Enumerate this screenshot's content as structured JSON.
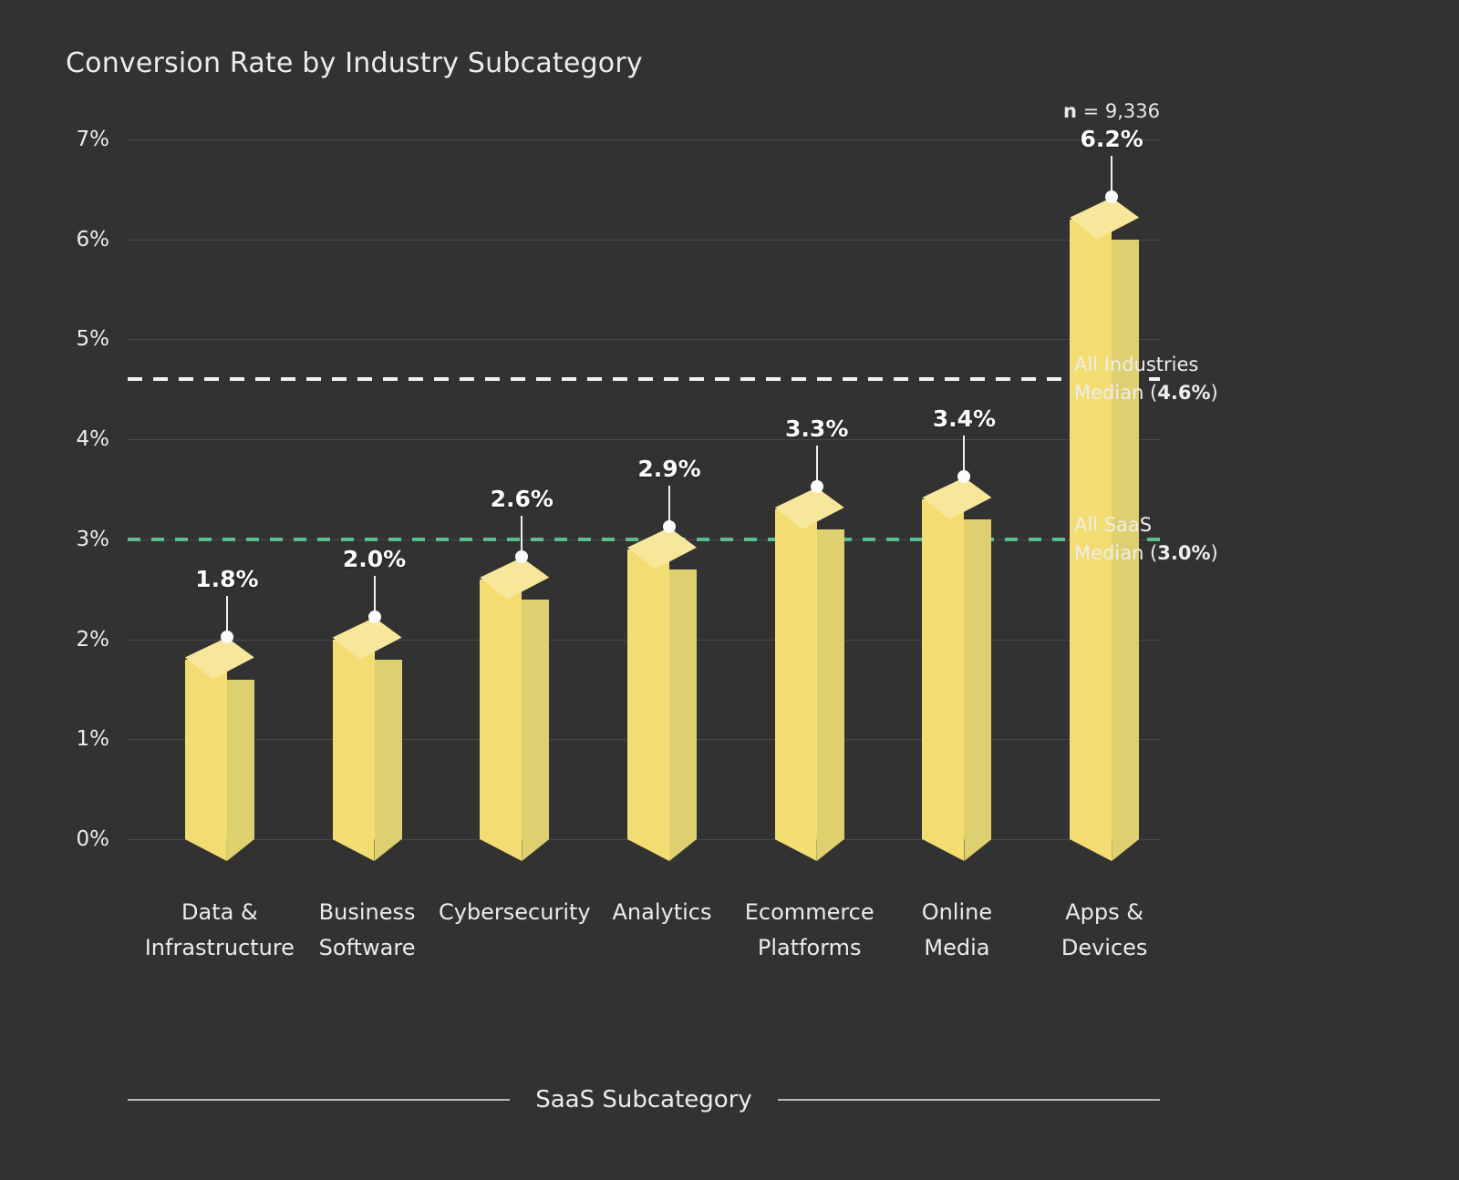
{
  "header": {
    "title": "Conversion Rate by Industry Subcategory",
    "sample_size_prefix": "n",
    "sample_size_value": "= 9,336"
  },
  "axes": {
    "x_title": "SaaS Subcategory",
    "y_ticks": [
      "7%",
      "6%",
      "5%",
      "4%",
      "3%",
      "2%",
      "1%",
      "0%"
    ]
  },
  "reference_lines": [
    {
      "name": "all-industries-median",
      "line1": "All Industries",
      "line2_prefix": "Median (",
      "line2_value": "4.6%",
      "line2_suffix": ")",
      "color": "#f2f2f2",
      "value": 4.6
    },
    {
      "name": "all-saas-median",
      "line1": "All SaaS",
      "line2_prefix": "Median (",
      "line2_value": "3.0%",
      "line2_suffix": ")",
      "color": "#5bbd8e",
      "value": 3.0
    }
  ],
  "colors": {
    "background": "#333232",
    "bar_front": "#f3dc71",
    "bar_side": "#ded06f",
    "bar_top": "#f7e79b",
    "gridline": "#4a4949",
    "accent_green": "#5bbd8e",
    "text": "#ececec"
  },
  "chart_data": {
    "type": "bar",
    "title": "Conversion Rate by Industry Subcategory",
    "xlabel": "SaaS Subcategory",
    "ylabel": "",
    "ylim": [
      0,
      7
    ],
    "y_tick_values": [
      0,
      1,
      2,
      3,
      4,
      5,
      6,
      7
    ],
    "y_tick_labels": [
      "0%",
      "1%",
      "2%",
      "3%",
      "4%",
      "5%",
      "6%",
      "7%"
    ],
    "grid": true,
    "legend": "none",
    "annotation": "n = 9,336",
    "categories": [
      "Data &\nInfrastructure",
      "Business\nSoftware",
      "Cybersecurity",
      "Analytics",
      "Ecommerce\nPlatforms",
      "Online\nMedia",
      "Apps &\nDevices"
    ],
    "values": [
      1.8,
      2.0,
      2.6,
      2.9,
      3.3,
      3.4,
      6.2
    ],
    "value_labels": [
      "1.8%",
      "2.0%",
      "2.6%",
      "2.9%",
      "3.3%",
      "3.4%",
      "6.2%"
    ],
    "reference_lines": [
      {
        "label": "All Industries Median",
        "value": 4.6,
        "style": "dashed",
        "color": "#f2f2f2"
      },
      {
        "label": "All SaaS Median",
        "value": 3.0,
        "style": "dashed",
        "color": "#5bbd8e"
      }
    ]
  },
  "bars": [
    {
      "label_line1": "Data &",
      "label_line2": "Infrastructure",
      "value_label": "1.8%",
      "value": 1.8
    },
    {
      "label_line1": "Business",
      "label_line2": "Software",
      "value_label": "2.0%",
      "value": 2.0
    },
    {
      "label_line1": "Cybersecurity",
      "label_line2": "",
      "value_label": "2.6%",
      "value": 2.6
    },
    {
      "label_line1": "Analytics",
      "label_line2": "",
      "value_label": "2.9%",
      "value": 2.9
    },
    {
      "label_line1": "Ecommerce",
      "label_line2": "Platforms",
      "value_label": "3.3%",
      "value": 3.3
    },
    {
      "label_line1": "Online",
      "label_line2": "Media",
      "value_label": "3.4%",
      "value": 3.4
    },
    {
      "label_line1": "Apps &",
      "label_line2": "Devices",
      "value_label": "6.2%",
      "value": 6.2
    }
  ]
}
